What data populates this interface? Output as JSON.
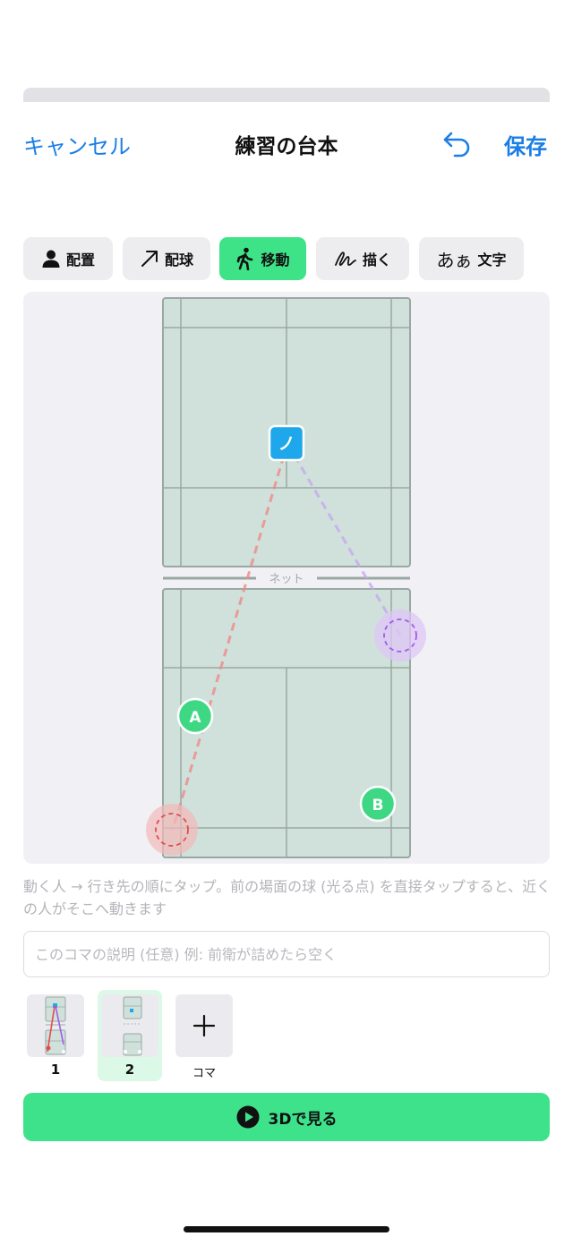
{
  "nav": {
    "cancel": "キャンセル",
    "title": "練習の台本",
    "save": "保存"
  },
  "tools": [
    {
      "label": "配置",
      "icon": "person-icon",
      "active": false
    },
    {
      "label": "配球",
      "icon": "arrow-up-right-icon",
      "active": false
    },
    {
      "label": "移動",
      "icon": "walking-icon",
      "active": true
    },
    {
      "label": "描く",
      "icon": "scribble-icon",
      "active": false
    },
    {
      "label": "文字",
      "icon_text": "あぁ",
      "icon": "text-icon",
      "active": false
    }
  ],
  "court": {
    "net_label": "ネット",
    "players": [
      {
        "label": "ノ",
        "color": "#1ea7ea"
      },
      {
        "label": "A",
        "color": "#3ed884"
      },
      {
        "label": "B",
        "color": "#3ed884"
      }
    ],
    "colors": {
      "court_fill": "#cfe1da",
      "court_line": "#9aa7a3",
      "red_path": "#ef8a8a",
      "purple_path": "#c9a8ee"
    }
  },
  "hint": "動く人 → 行き先の順にタップ。前の場面の球 (光る点) を直接タップすると、近くの人がそこへ動きます",
  "description_input": {
    "placeholder": "このコマの説明 (任意) 例: 前衛が詰めたら空く",
    "value": ""
  },
  "frames": [
    {
      "number": "1",
      "selected": false
    },
    {
      "number": "2",
      "selected": true
    }
  ],
  "add_frame_label": "コマ",
  "play_button": "3Dで見る",
  "accent": {
    "link": "#1a7ee6",
    "green": "#3ee287"
  }
}
